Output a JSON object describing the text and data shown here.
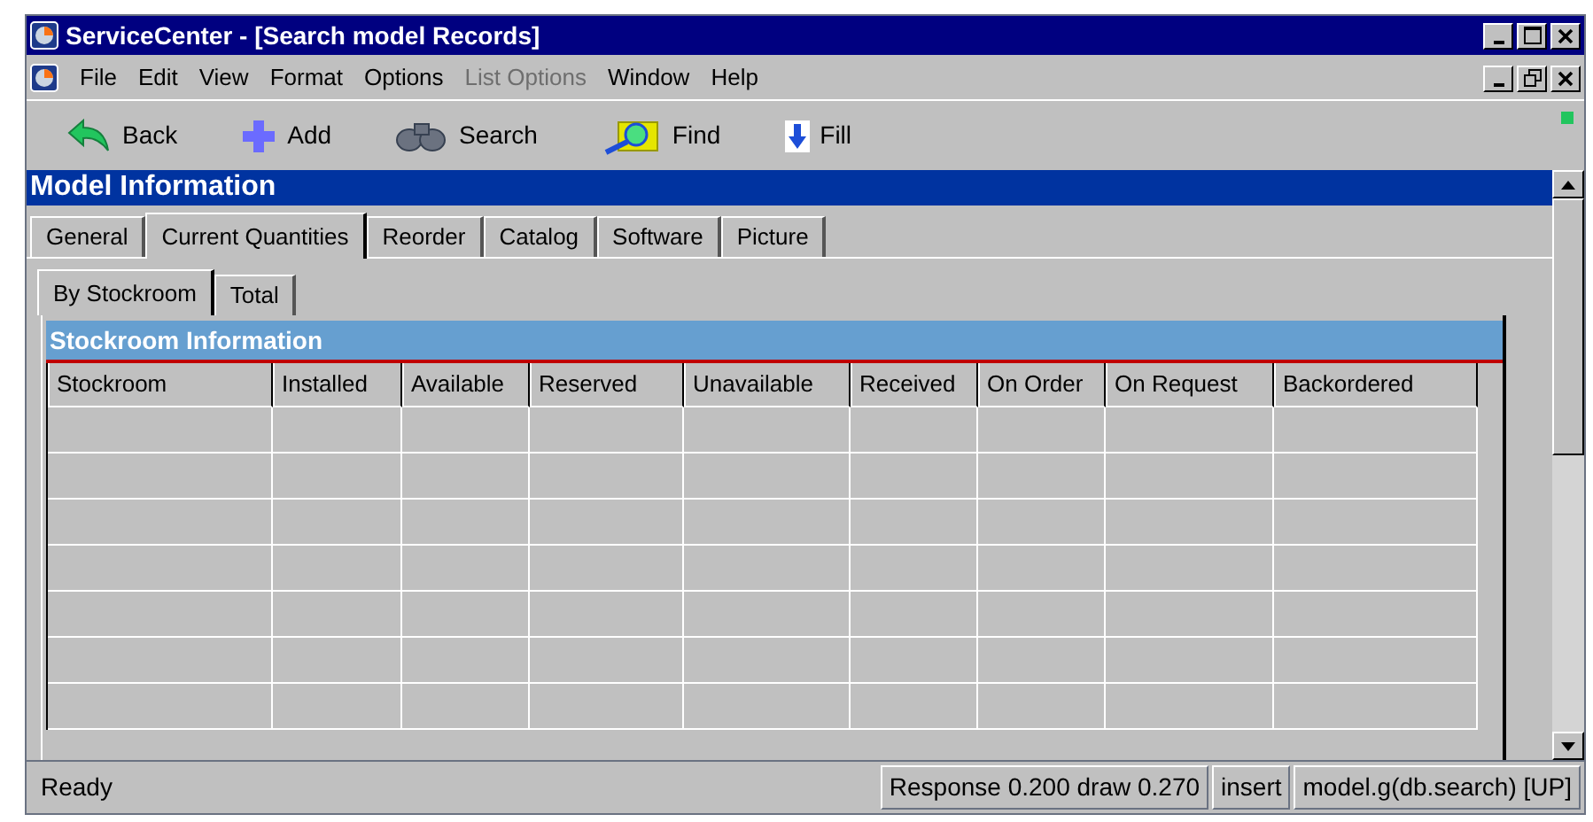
{
  "window": {
    "title": "ServiceCenter - [Search model Records]"
  },
  "menu": [
    {
      "label": "File",
      "disabled": false
    },
    {
      "label": "Edit",
      "disabled": false
    },
    {
      "label": "View",
      "disabled": false
    },
    {
      "label": "Format",
      "disabled": false
    },
    {
      "label": "Options",
      "disabled": false
    },
    {
      "label": "List Options",
      "disabled": true
    },
    {
      "label": "Window",
      "disabled": false
    },
    {
      "label": "Help",
      "disabled": false
    }
  ],
  "toolbar": [
    {
      "kind": "back",
      "label": "Back"
    },
    {
      "kind": "add",
      "label": "Add"
    },
    {
      "kind": "search",
      "label": "Search"
    },
    {
      "kind": "find",
      "label": "Find"
    },
    {
      "kind": "fill",
      "label": "Fill"
    }
  ],
  "section_title": "Model Information",
  "tabs": [
    {
      "label": "General",
      "selected": false
    },
    {
      "label": "Current Quantities",
      "selected": true
    },
    {
      "label": "Reorder",
      "selected": false
    },
    {
      "label": "Catalog",
      "selected": false
    },
    {
      "label": "Software",
      "selected": false
    },
    {
      "label": "Picture",
      "selected": false
    }
  ],
  "subtabs": [
    {
      "label": "By Stockroom",
      "selected": true
    },
    {
      "label": "Total",
      "selected": false
    }
  ],
  "table": {
    "title": "Stockroom Information",
    "columns": [
      "Stockroom",
      "Installed",
      "Available",
      "Reserved",
      "Unavailable",
      "Received",
      "On Order",
      "On Request",
      "Backordered"
    ]
  },
  "status_bar": {
    "message": "Ready",
    "timing": "Response 0.200 draw 0.270",
    "mode": "insert",
    "context": "model.g(db.search) [UP]"
  }
}
